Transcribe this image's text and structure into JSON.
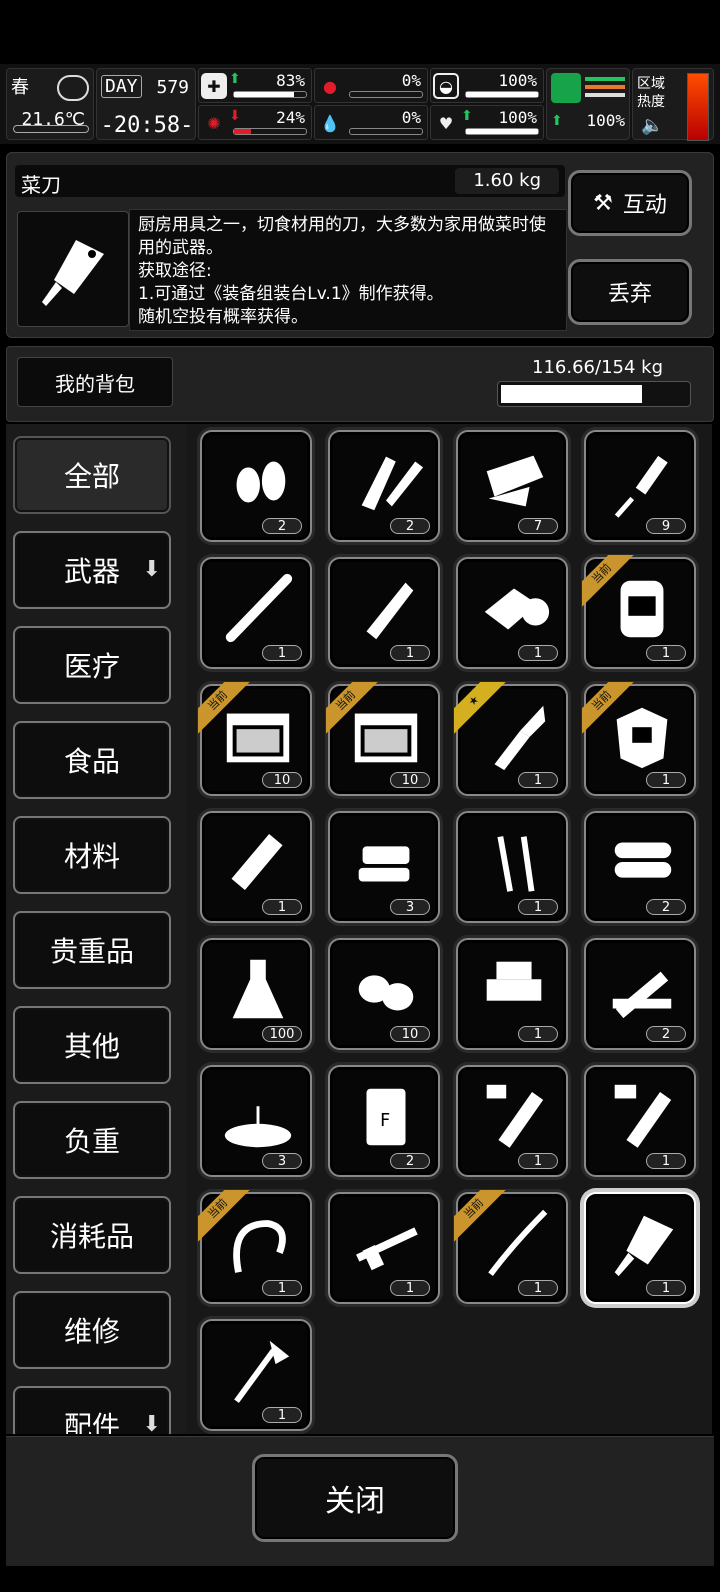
{
  "status": {
    "season": "春",
    "temperature": "21.6℃",
    "day_label": "DAY",
    "day_number": "579",
    "clock": "-20:58-",
    "stats": [
      {
        "name": "health",
        "value": "83%",
        "trend": "up",
        "fill": 0.83
      },
      {
        "name": "hunger",
        "value": "0%",
        "trend": "none",
        "fill": 0.0
      },
      {
        "name": "armor",
        "value": "100%",
        "trend": "none",
        "fill": 1.0
      },
      {
        "name": "infection",
        "value": "24%",
        "trend": "down",
        "fill": 0.24
      },
      {
        "name": "blood",
        "value": "0%",
        "trend": "none",
        "fill": 0.0
      },
      {
        "name": "mood",
        "value": "100%",
        "trend": "up",
        "fill": 1.0
      }
    ],
    "stamina": {
      "value": "100%",
      "trend": "up"
    },
    "region_heat_label": "区域\n热度"
  },
  "item": {
    "name": "菜刀",
    "weight": "1.60 kg",
    "description": "厨房用具之一，切食材用的刀，大多数为家用做菜时使用的武器。\n获取途径:\n1.可通过《装备组装台Lv.1》制作获得。\n随机空投有概率获得。",
    "interact_label": "互动",
    "drop_label": "丢弃"
  },
  "backpack": {
    "title": "我的背包",
    "weight": "116.66/154 kg",
    "fill": 0.7575
  },
  "categories": [
    {
      "label": "全部",
      "active": true,
      "has_arrow": false
    },
    {
      "label": "武器",
      "active": false,
      "has_arrow": true
    },
    {
      "label": "医疗",
      "active": false,
      "has_arrow": false
    },
    {
      "label": "食品",
      "active": false,
      "has_arrow": false
    },
    {
      "label": "材料",
      "active": false,
      "has_arrow": false
    },
    {
      "label": "贵重品",
      "active": false,
      "has_arrow": false
    },
    {
      "label": "其他",
      "active": false,
      "has_arrow": false
    },
    {
      "label": "负重",
      "active": false,
      "has_arrow": false
    },
    {
      "label": "消耗品",
      "active": false,
      "has_arrow": false
    },
    {
      "label": "维修",
      "active": false,
      "has_arrow": false
    },
    {
      "label": "配件",
      "active": false,
      "has_arrow": true
    }
  ],
  "current_badge": "当前",
  "items": [
    {
      "icon": "bullets-icon",
      "count": "2",
      "badge": ""
    },
    {
      "icon": "rocket-launcher-icon",
      "count": "2",
      "badge": ""
    },
    {
      "icon": "cloth-scraps-icon",
      "count": "7",
      "badge": ""
    },
    {
      "icon": "suppressor-icon",
      "count": "9",
      "badge": ""
    },
    {
      "icon": "pipe-icon",
      "count": "1",
      "badge": ""
    },
    {
      "icon": "bullet-casing-icon",
      "count": "1",
      "badge": ""
    },
    {
      "icon": "bandage-roll-icon",
      "count": "1",
      "badge": ""
    },
    {
      "icon": "backpack-icon",
      "count": "1",
      "badge": "current"
    },
    {
      "icon": "ammo-box-icon",
      "count": "10",
      "badge": "current"
    },
    {
      "icon": "ammo-box-icon",
      "count": "10",
      "badge": "current"
    },
    {
      "icon": "combat-knife-icon",
      "count": "1",
      "badge": "star"
    },
    {
      "icon": "body-armor-icon",
      "count": "1",
      "badge": "current"
    },
    {
      "icon": "flashlight-icon",
      "count": "1",
      "badge": ""
    },
    {
      "icon": "soap-bars-icon",
      "count": "3",
      "badge": ""
    },
    {
      "icon": "screws-icon",
      "count": "1",
      "badge": ""
    },
    {
      "icon": "logs-icon",
      "count": "2",
      "badge": ""
    },
    {
      "icon": "flask-icon",
      "count": "100",
      "badge": ""
    },
    {
      "icon": "coffee-beans-icon",
      "count": "10",
      "badge": ""
    },
    {
      "icon": "wood-blocks-icon",
      "count": "1",
      "badge": ""
    },
    {
      "icon": "planks-icon",
      "count": "2",
      "badge": ""
    },
    {
      "icon": "soil-sprout-icon",
      "count": "3",
      "badge": ""
    },
    {
      "icon": "fertilizer-bag-icon",
      "count": "2",
      "badge": ""
    },
    {
      "icon": "test-tube-ii-icon",
      "count": "1",
      "badge": ""
    },
    {
      "icon": "test-tube-vi-icon",
      "count": "1",
      "badge": ""
    },
    {
      "icon": "whip-icon",
      "count": "1",
      "badge": "current"
    },
    {
      "icon": "sniper-rifle-icon",
      "count": "1",
      "badge": ""
    },
    {
      "icon": "katana-icon",
      "count": "1",
      "badge": "current"
    },
    {
      "icon": "cleaver-icon",
      "count": "1",
      "badge": "",
      "selected": true
    },
    {
      "icon": "axe-icon",
      "count": "1",
      "badge": ""
    }
  ],
  "close_label": "关闭"
}
